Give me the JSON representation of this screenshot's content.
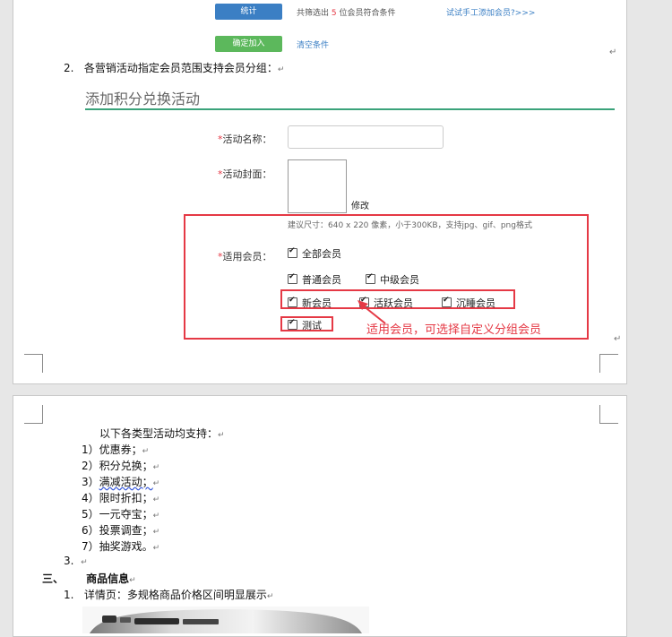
{
  "top_bar": {
    "stat_button": "统计",
    "summary_prefix": "共筛选出",
    "summary_count": "5",
    "summary_suffix": "位会员符合条件",
    "manual_link": "试试手工添加会员?>>>",
    "confirm_button": "确定加入",
    "clear_link": "清空条件"
  },
  "item2": {
    "number": "2.",
    "text": "各营销活动指定会员范围支持会员分组："
  },
  "form": {
    "title": "添加积分兑换活动",
    "name_label": "活动名称：",
    "name_value": "",
    "cover_label": "活动封面：",
    "modify_link": "修改",
    "size_hint": "建议尺寸：640 x 220 像素，小于300KB，支持jpg、gif、png格式",
    "member_label": "适用会员：",
    "required_mark": "*",
    "checkboxes": {
      "all": "全部会员",
      "normal": "普通会员",
      "mid": "中级会员",
      "new": "新会员",
      "active": "活跃会员",
      "sleep": "沉睡会员",
      "test": "测试"
    },
    "annotation": "适用会员，可选择自定义分组会员"
  },
  "page2": {
    "intro": "以下各类型活动均支持：",
    "items": [
      {
        "num": "1）",
        "text": "优惠券；"
      },
      {
        "num": "2）",
        "text": "积分兑换；"
      },
      {
        "num": "3）",
        "text": "满减活动；"
      },
      {
        "num": "4）",
        "text": "限时折扣；"
      },
      {
        "num": "5）",
        "text": "一元夺宝；"
      },
      {
        "num": "6）",
        "text": "投票调查；"
      },
      {
        "num": "7）",
        "text": "抽奖游戏。"
      }
    ],
    "item3_number": "3.",
    "section_number": "三、",
    "section_title": "商品信息",
    "detail_number": "1.",
    "detail_text": "详情页：多规格商品价格区间明显展示"
  },
  "colors": {
    "stat_button": "#3b7fc4",
    "confirm_button": "#5cb85c",
    "link": "#3b7fc4",
    "title_underline": "#3aa37a",
    "highlight": "#e53945"
  }
}
